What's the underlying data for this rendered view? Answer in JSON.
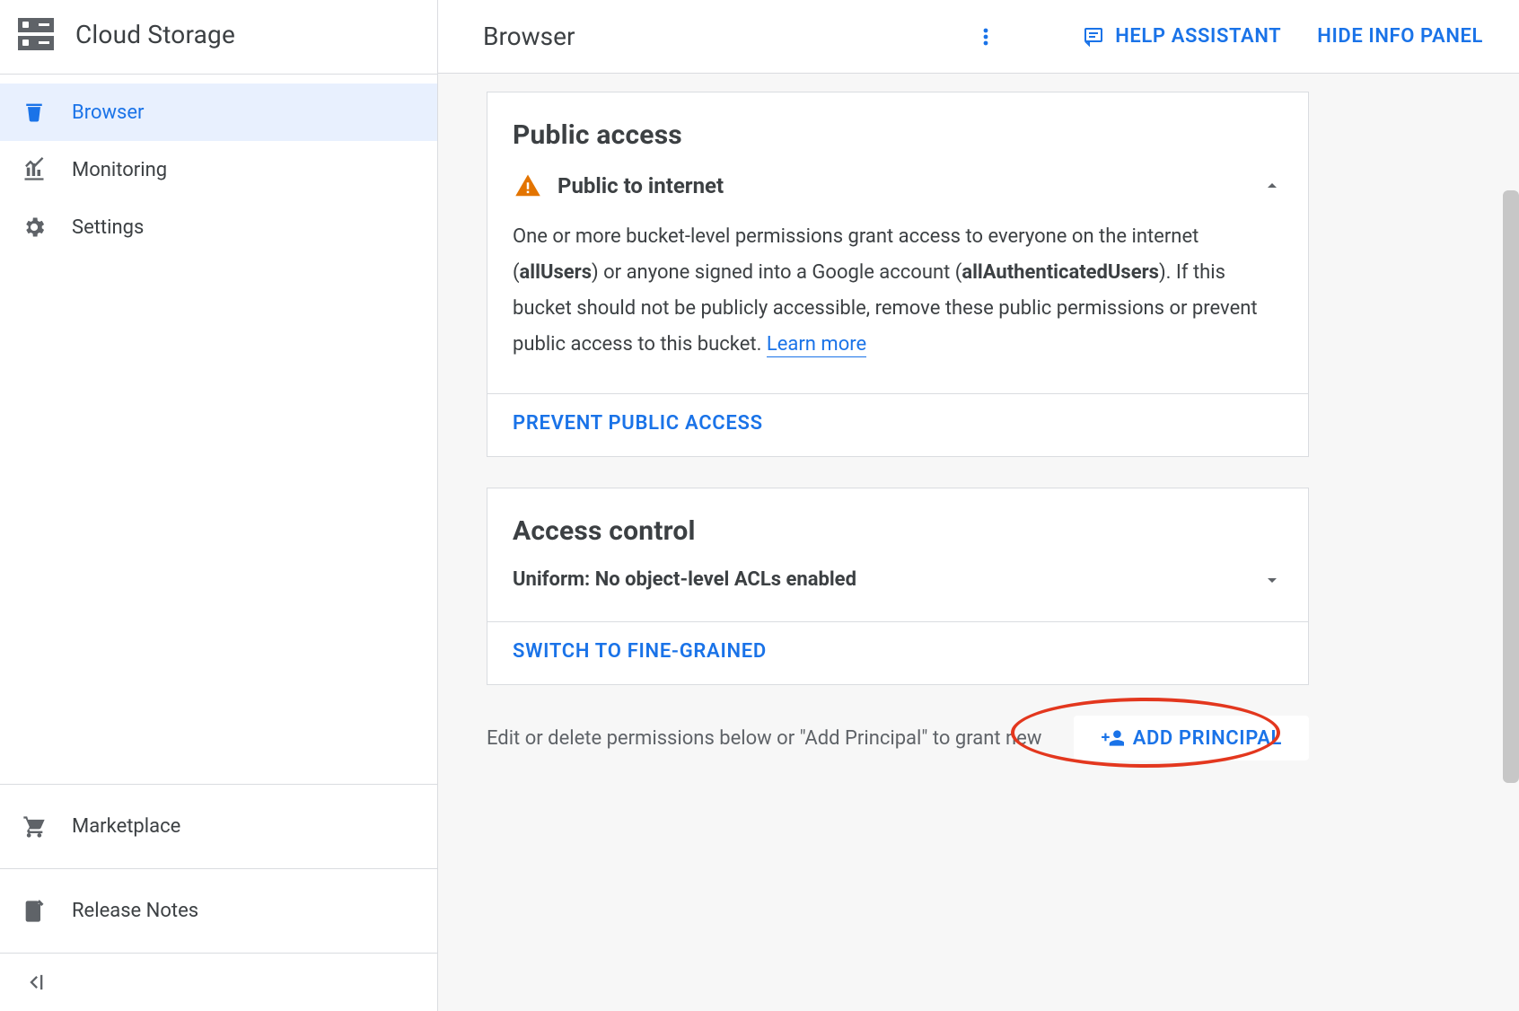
{
  "sidebar": {
    "product_title": "Cloud Storage",
    "nav": [
      {
        "label": "Browser",
        "icon": "bucket-icon",
        "active": true
      },
      {
        "label": "Monitoring",
        "icon": "chart-icon",
        "active": false
      },
      {
        "label": "Settings",
        "icon": "gear-icon",
        "active": false
      }
    ],
    "footer": [
      {
        "label": "Marketplace",
        "icon": "marketplace-icon"
      },
      {
        "label": "Release Notes",
        "icon": "release-notes-icon"
      }
    ]
  },
  "header": {
    "page_title": "Browser",
    "help_label": "HELP ASSISTANT",
    "hide_panel_label": "HIDE INFO PANEL"
  },
  "public_access": {
    "card_title": "Public access",
    "status_heading": "Public to internet",
    "desc_prefix": "One or more bucket-level permissions grant access to everyone on the internet (",
    "desc_bold1": "allUsers",
    "desc_mid": ") or anyone signed into a Google account (",
    "desc_bold2": "allAuthenticatedUsers",
    "desc_suffix": "). If this bucket should not be publicly accessible, remove these public permissions or prevent public access to this bucket. ",
    "learn_label": "Learn more",
    "action_label": "PREVENT PUBLIC ACCESS"
  },
  "access_control": {
    "card_title": "Access control",
    "subheading": "Uniform: No object-level ACLs enabled",
    "action_label": "SWITCH TO FINE-GRAINED"
  },
  "permissions": {
    "description": "Edit or delete permissions below or \"Add Principal\" to grant new",
    "add_button": "ADD PRINCIPAL"
  },
  "colors": {
    "accent": "#1a73e8",
    "warning": "#e37400",
    "highlight": "#e3371e"
  }
}
